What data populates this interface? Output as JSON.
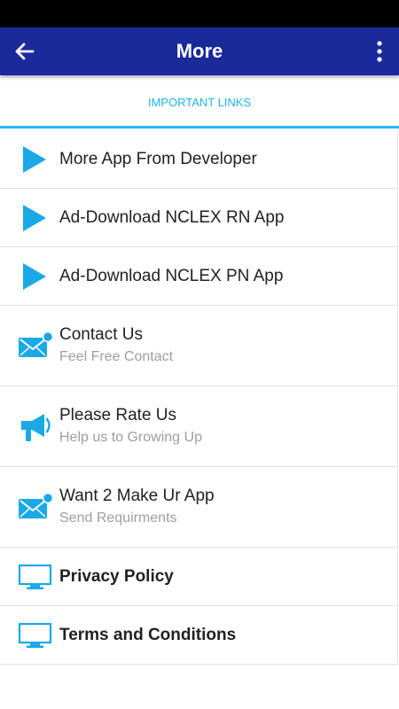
{
  "app_bar": {
    "title": "More",
    "color": "#1a2a9a",
    "back_icon": "arrow-back-icon",
    "menu_icon": "more-vert-icon"
  },
  "tab": {
    "label": "IMPORTANT LINKS",
    "accent": "#29b6f6"
  },
  "items": [
    {
      "title": "More App From Developer",
      "icon": "play-icon"
    },
    {
      "title": "Ad-Download NCLEX RN App",
      "icon": "play-icon"
    },
    {
      "title": "Ad-Download NCLEX PN App",
      "icon": "play-icon"
    },
    {
      "title": "Contact Us",
      "subtitle": "Feel Free Contact",
      "icon": "mail-icon"
    },
    {
      "title": "Please Rate Us",
      "subtitle": "Help us to Growing Up",
      "icon": "megaphone-icon"
    },
    {
      "title": "Want 2 Make Ur App",
      "subtitle": "Send Requirments",
      "icon": "mail-icon"
    },
    {
      "title": "Privacy Policy",
      "icon": "monitor-icon"
    },
    {
      "title": "Terms and Conditions",
      "icon": "monitor-icon"
    }
  ]
}
